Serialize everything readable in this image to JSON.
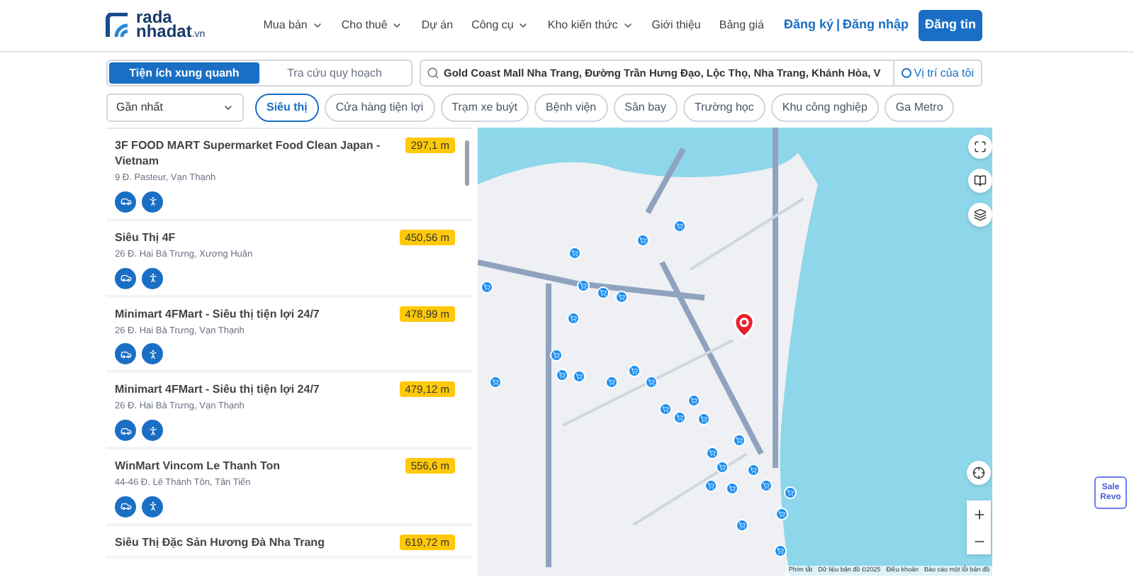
{
  "header": {
    "logo_top": "rada",
    "logo_bottom": "nhadat",
    "logo_suffix": ".vn",
    "nav": [
      {
        "label": "Mua bán",
        "dropdown": true
      },
      {
        "label": "Cho thuê",
        "dropdown": true
      },
      {
        "label": "Dự án",
        "dropdown": false
      },
      {
        "label": "Công cụ",
        "dropdown": true
      },
      {
        "label": "Kho kiến thức",
        "dropdown": true
      },
      {
        "label": "Giới thiệu",
        "dropdown": false
      },
      {
        "label": "Bảng giá",
        "dropdown": false
      }
    ],
    "register": "Đăng ký",
    "separator": "|",
    "login": "Đăng nhập",
    "post_button": "Đăng tin"
  },
  "mode_tabs": [
    {
      "label": "Tiện ích xung quanh",
      "selected": true
    },
    {
      "label": "Tra cứu quy hoạch",
      "selected": false
    }
  ],
  "search": {
    "value": "Gold Coast Mall Nha Trang, Đường Trần Hưng Đạo, Lộc Thọ, Nha Trang, Khánh Hòa, V",
    "location_button": "Vị trí của tôi"
  },
  "sort_select": {
    "value": "Gần nhất"
  },
  "categories": [
    {
      "label": "Siêu thị",
      "selected": true
    },
    {
      "label": "Cửa hàng tiện lợi",
      "selected": false
    },
    {
      "label": "Trạm xe buýt",
      "selected": false
    },
    {
      "label": "Bệnh viện",
      "selected": false
    },
    {
      "label": "Sân bay",
      "selected": false
    },
    {
      "label": "Trường học",
      "selected": false
    },
    {
      "label": "Khu công nghiệp",
      "selected": false
    },
    {
      "label": "Ga Metro",
      "selected": false
    }
  ],
  "places": [
    {
      "name": "3F FOOD MART Supermarket Food Clean Japan - Vietnam",
      "address": "9 Đ. Pasteur, Vạn Thạnh",
      "distance": "297,1 m"
    },
    {
      "name": "Siêu Thị 4F",
      "address": "26 Đ. Hai Bà Trưng, Xương Huân",
      "distance": "450,56 m"
    },
    {
      "name": "Minimart 4FMart - Siêu thị tiện lợi 24/7",
      "address": "26 Đ. Hai Bà Trưng, Vạn Thạnh",
      "distance": "478,99 m"
    },
    {
      "name": "Minimart 4FMart - Siêu thị tiện lợi 24/7",
      "address": "26 Đ. Hai Bà Trưng, Vạn Thạnh",
      "distance": "479,12 m"
    },
    {
      "name": "WinMart Vincom Le Thanh Ton",
      "address": "44-46 Đ. Lê Thánh Tôn, Tân Tiến",
      "distance": "556,6 m"
    },
    {
      "name": "Siêu Thị Đặc Sản Hương Đà Nha Trang",
      "distance": "619,72 m"
    }
  ],
  "map_footer": [
    "Phím tắt",
    "Dữ liệu bản đồ ©2025",
    "Điều khoản",
    "Báo cáo một lỗi bản đồ"
  ],
  "chat_badge": {
    "line1": "Sale",
    "line2": "Revo"
  }
}
